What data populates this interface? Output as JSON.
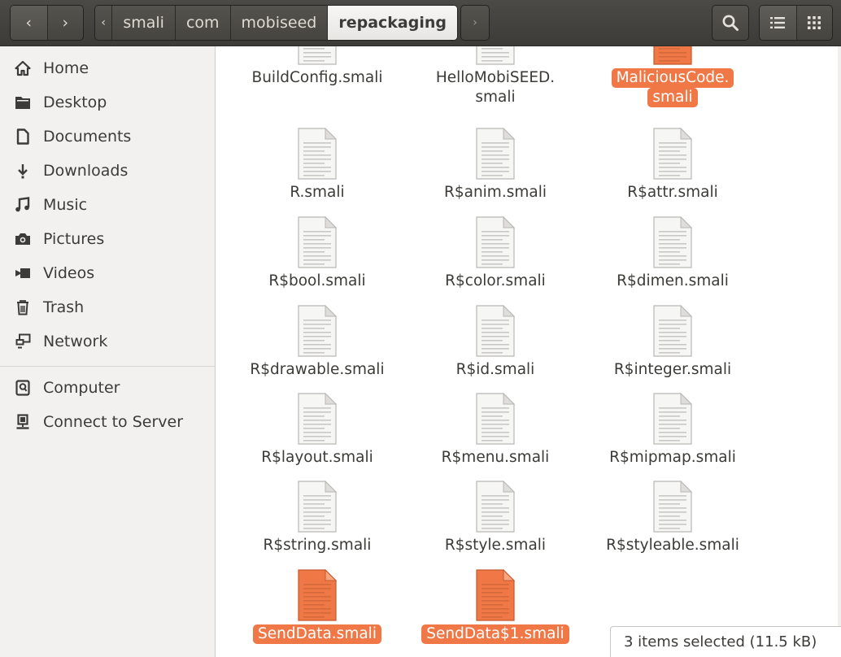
{
  "header": {
    "back_glyph": "‹",
    "forward_glyph": "›",
    "breadcrumbs": [
      "smali",
      "com",
      "mobiseed",
      "repackaging"
    ],
    "breadcrumb_left_arrow": "‹",
    "breadcrumb_right_arrow": "›"
  },
  "sidebar": {
    "items": [
      {
        "label": "Home",
        "icon": "home-icon"
      },
      {
        "label": "Desktop",
        "icon": "folder-icon"
      },
      {
        "label": "Documents",
        "icon": "document-icon"
      },
      {
        "label": "Downloads",
        "icon": "download-icon"
      },
      {
        "label": "Music",
        "icon": "music-icon"
      },
      {
        "label": "Pictures",
        "icon": "camera-icon"
      },
      {
        "label": "Videos",
        "icon": "video-icon"
      },
      {
        "label": "Trash",
        "icon": "trash-icon"
      },
      {
        "label": "Network",
        "icon": "network-icon"
      }
    ],
    "devices": [
      {
        "label": "Computer",
        "icon": "computer-icon"
      },
      {
        "label": "Connect to Server",
        "icon": "server-icon"
      }
    ]
  },
  "files": [
    {
      "name": "BuildConfig.smali",
      "line1": "BuildConfig.smali",
      "line2": "",
      "selected": false
    },
    {
      "name": "HelloMobiSEED.smali",
      "line1": "HelloMobiSEED.",
      "line2": "smali",
      "selected": false
    },
    {
      "name": "MaliciousCode.smali",
      "line1": "MaliciousCode.",
      "line2": "smali",
      "selected": true
    },
    {
      "name": "R.smali",
      "line1": "R.smali",
      "line2": "",
      "selected": false
    },
    {
      "name": "R$anim.smali",
      "line1": "R$anim.smali",
      "line2": "",
      "selected": false
    },
    {
      "name": "R$attr.smali",
      "line1": "R$attr.smali",
      "line2": "",
      "selected": false
    },
    {
      "name": "R$bool.smali",
      "line1": "R$bool.smali",
      "line2": "",
      "selected": false
    },
    {
      "name": "R$color.smali",
      "line1": "R$color.smali",
      "line2": "",
      "selected": false
    },
    {
      "name": "R$dimen.smali",
      "line1": "R$dimen.smali",
      "line2": "",
      "selected": false
    },
    {
      "name": "R$drawable.smali",
      "line1": "R$drawable.smali",
      "line2": "",
      "selected": false
    },
    {
      "name": "R$id.smali",
      "line1": "R$id.smali",
      "line2": "",
      "selected": false
    },
    {
      "name": "R$integer.smali",
      "line1": "R$integer.smali",
      "line2": "",
      "selected": false
    },
    {
      "name": "R$layout.smali",
      "line1": "R$layout.smali",
      "line2": "",
      "selected": false
    },
    {
      "name": "R$menu.smali",
      "line1": "R$menu.smali",
      "line2": "",
      "selected": false
    },
    {
      "name": "R$mipmap.smali",
      "line1": "R$mipmap.smali",
      "line2": "",
      "selected": false
    },
    {
      "name": "R$string.smali",
      "line1": "R$string.smali",
      "line2": "",
      "selected": false
    },
    {
      "name": "R$style.smali",
      "line1": "R$style.smali",
      "line2": "",
      "selected": false
    },
    {
      "name": "R$styleable.smali",
      "line1": "R$styleable.smali",
      "line2": "",
      "selected": false
    },
    {
      "name": "SendData.smali",
      "line1": "SendData.smali",
      "line2": "",
      "selected": true
    },
    {
      "name": "SendData$1.smali",
      "line1": "SendData$1.smali",
      "line2": "",
      "selected": true
    }
  ],
  "status": {
    "text": "3 items selected  (11.5 kB)"
  },
  "colors": {
    "selection": "#f07746",
    "header": "#3c3b37",
    "sidebar": "#f2f1f0"
  }
}
